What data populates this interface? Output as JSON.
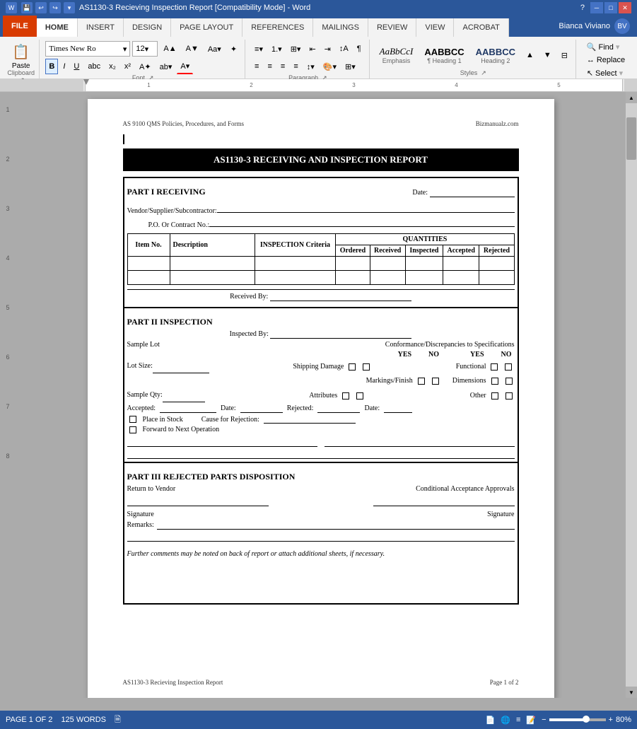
{
  "titlebar": {
    "title": "AS1130-3 Recieving Inspection Report [Compatibility Mode] - Word",
    "user": "Bianca Viviano",
    "help_icon": "?",
    "minimize": "─",
    "maximize": "□",
    "close": "✕"
  },
  "tabs": {
    "file": "FILE",
    "home": "HOME",
    "insert": "INSERT",
    "design": "DESIGN",
    "page_layout": "PAGE LAYOUT",
    "references": "REFERENCES",
    "mailings": "MAILINGS",
    "review": "REVIEW",
    "view": "VIEW",
    "acrobat": "ACROBAT"
  },
  "toolbar": {
    "paste": "Paste",
    "font_name": "Times New Ro",
    "font_size": "12",
    "bold": "B",
    "italic": "I",
    "underline": "U",
    "find": "Find",
    "replace": "Replace",
    "select": "Select"
  },
  "styles": {
    "emphasis_label": "Emphasis",
    "h1_label": "¶ Heading 1",
    "h2_label": "Heading 2"
  },
  "document": {
    "header_left": "AS 9100 QMS Policies, Procedures, and Forms",
    "header_right": "Bizmanualz.com",
    "title": "AS1130-3 RECEIVING AND INSPECTION REPORT",
    "part1": {
      "heading": "PART I RECEIVING",
      "date_label": "Date:",
      "vendor_label": "Vendor/Supplier/Subcontractor:",
      "po_label": "P.O.  Or Contract No.:",
      "table_headers": {
        "item_no": "Item No.",
        "description": "Description",
        "inspection_criteria": "INSPECTION Criteria",
        "quantities": "QUANTITIES",
        "ordered": "Ordered",
        "received": "Received",
        "inspected": "Inspected",
        "accepted": "Accepted",
        "rejected": "Rejected"
      },
      "received_by": "Received By:"
    },
    "part2": {
      "heading": "PART II INSPECTION",
      "inspected_by": "Inspected By:",
      "sample_lot": "Sample Lot",
      "conformance": "Conformance/Discrepancies to Specifications",
      "yes": "YES",
      "no": "NO",
      "lot_size": "Lot Size:",
      "shipping_damage": "Shipping Damage",
      "functional": "Functional",
      "markings_finish": "Markings/Finish",
      "dimensions": "Dimensions",
      "sample_qty": "Sample Qty:",
      "attributes": "Attributes",
      "other": "Other",
      "accepted_label": "Accepted:",
      "date_label": "Date:",
      "rejected_label": "Rejected:",
      "date2_label": "Date:",
      "place_in_stock": "Place in Stock",
      "cause_for_rejection": "Cause for Rejection:",
      "forward_to_next": "Forward to Next Operation"
    },
    "part3": {
      "heading": "PART III REJECTED PARTS DISPOSITION",
      "return_to_vendor": "Return to Vendor",
      "conditional": "Conditional Acceptance Approvals",
      "signature_label": "Signature",
      "signature_label2": "Signature",
      "remarks_label": "Remarks:"
    },
    "further_comments": "Further comments may be noted on back of report or attach additional sheets, if necessary.",
    "footer_left": "AS1130-3 Recieving Inspection Report",
    "footer_right": "Page 1 of 2"
  },
  "statusbar": {
    "pages": "PAGE 1 OF 2",
    "words": "125 WORDS",
    "zoom": "80%"
  }
}
